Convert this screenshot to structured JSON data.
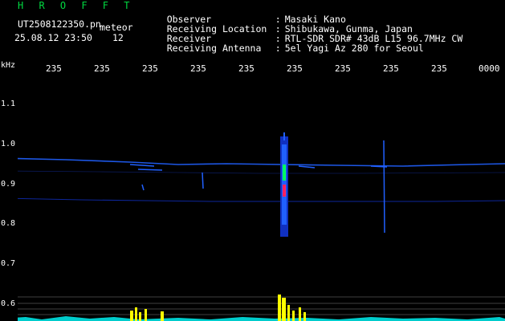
{
  "header": {
    "app_title": "H R O F F T",
    "filename": "UT2508122350.pn",
    "mode_label": "meteor",
    "datetime": "25.08.12 23:50",
    "count": "12",
    "info": [
      {
        "label": "Observer",
        "value": "Masaki Kano"
      },
      {
        "label": "Receiving Location",
        "value": "Shibukawa, Gunma, Japan"
      },
      {
        "label": "Receiver",
        "value": "RTL-SDR SDR# 43dB L15 96.7MHz CW"
      },
      {
        "label": "Receiving Antenna",
        "value": "5el Yagi Az 280 for Seoul"
      }
    ],
    "separator": ":"
  },
  "chart_data": {
    "type": "heatmap",
    "ylabel": "kHz",
    "y_ticks": [
      "1.1",
      "1.0",
      "0.9",
      "0.8",
      "0.7",
      "0.6"
    ],
    "time_ticks": [
      "235",
      "235",
      "235",
      "235",
      "235",
      "235",
      "235",
      "235",
      "235",
      "0000"
    ],
    "colors": {
      "background": "#000000",
      "weak": "#1030c0",
      "medium": "#2060ff",
      "strong": "#00ff60",
      "peak": "#ff2060",
      "bars": "#ffff00",
      "noise": "#00ffff"
    }
  }
}
